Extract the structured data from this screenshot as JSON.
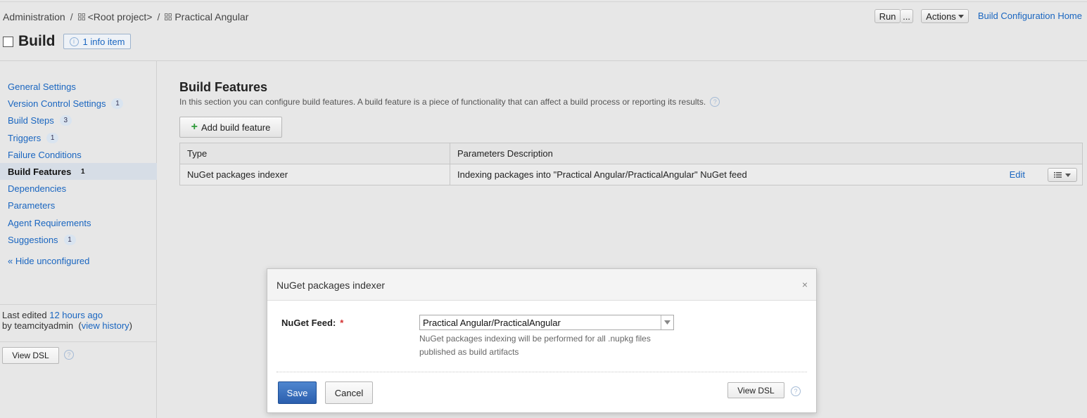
{
  "breadcrumb": {
    "items": [
      "Administration",
      "<Root project>",
      "Practical Angular"
    ],
    "separator": "/"
  },
  "page": {
    "title": "Build",
    "info_badge": "1 info item"
  },
  "header_actions": {
    "run": "Run",
    "more": "...",
    "actions": "Actions",
    "home_link": "Build Configuration Home"
  },
  "sidebar": {
    "items": [
      {
        "label": "General Settings",
        "count": null,
        "active": false
      },
      {
        "label": "Version Control Settings",
        "count": "1",
        "active": false
      },
      {
        "label": "Build Steps",
        "count": "3",
        "active": false
      },
      {
        "label": "Triggers",
        "count": "1",
        "active": false
      },
      {
        "label": "Failure Conditions",
        "count": null,
        "active": false
      },
      {
        "label": "Build Features",
        "count": "1",
        "active": true
      },
      {
        "label": "Dependencies",
        "count": null,
        "active": false
      },
      {
        "label": "Parameters",
        "count": null,
        "active": false
      },
      {
        "label": "Agent Requirements",
        "count": null,
        "active": false
      },
      {
        "label": "Suggestions",
        "count": "1",
        "active": false
      }
    ],
    "hide_unconfigured": "« Hide unconfigured",
    "last_edited_prefix": "Last edited",
    "last_edited_time": "12 hours ago",
    "edited_by_prefix": "by teamcityadmin",
    "view_history": "view history",
    "view_dsl": "View DSL"
  },
  "main": {
    "title": "Build Features",
    "description": "In this section you can configure build features. A build feature is a piece of functionality that can affect a build process or reporting its results.",
    "add_button": "Add build feature",
    "table": {
      "headers": [
        "Type",
        "Parameters Description"
      ],
      "rows": [
        {
          "type": "NuGet packages indexer",
          "description": "Indexing packages into \"Practical Angular/PracticalAngular\" NuGet feed",
          "edit": "Edit"
        }
      ]
    }
  },
  "modal": {
    "title": "NuGet packages indexer",
    "close": "×",
    "feed_label": "NuGet Feed:",
    "required_mark": "*",
    "feed_value": "Practical Angular/PracticalAngular",
    "feed_note": "NuGet packages indexing will be performed for all .nupkg files published as build artifacts",
    "save": "Save",
    "cancel": "Cancel",
    "view_dsl": "View DSL"
  },
  "icons": {
    "help": "?",
    "info": "i"
  },
  "colors": {
    "link": "#1a66c0",
    "primary_button": "#2b5fae",
    "required": "#d32f2f",
    "add_icon": "#2e9a39"
  }
}
